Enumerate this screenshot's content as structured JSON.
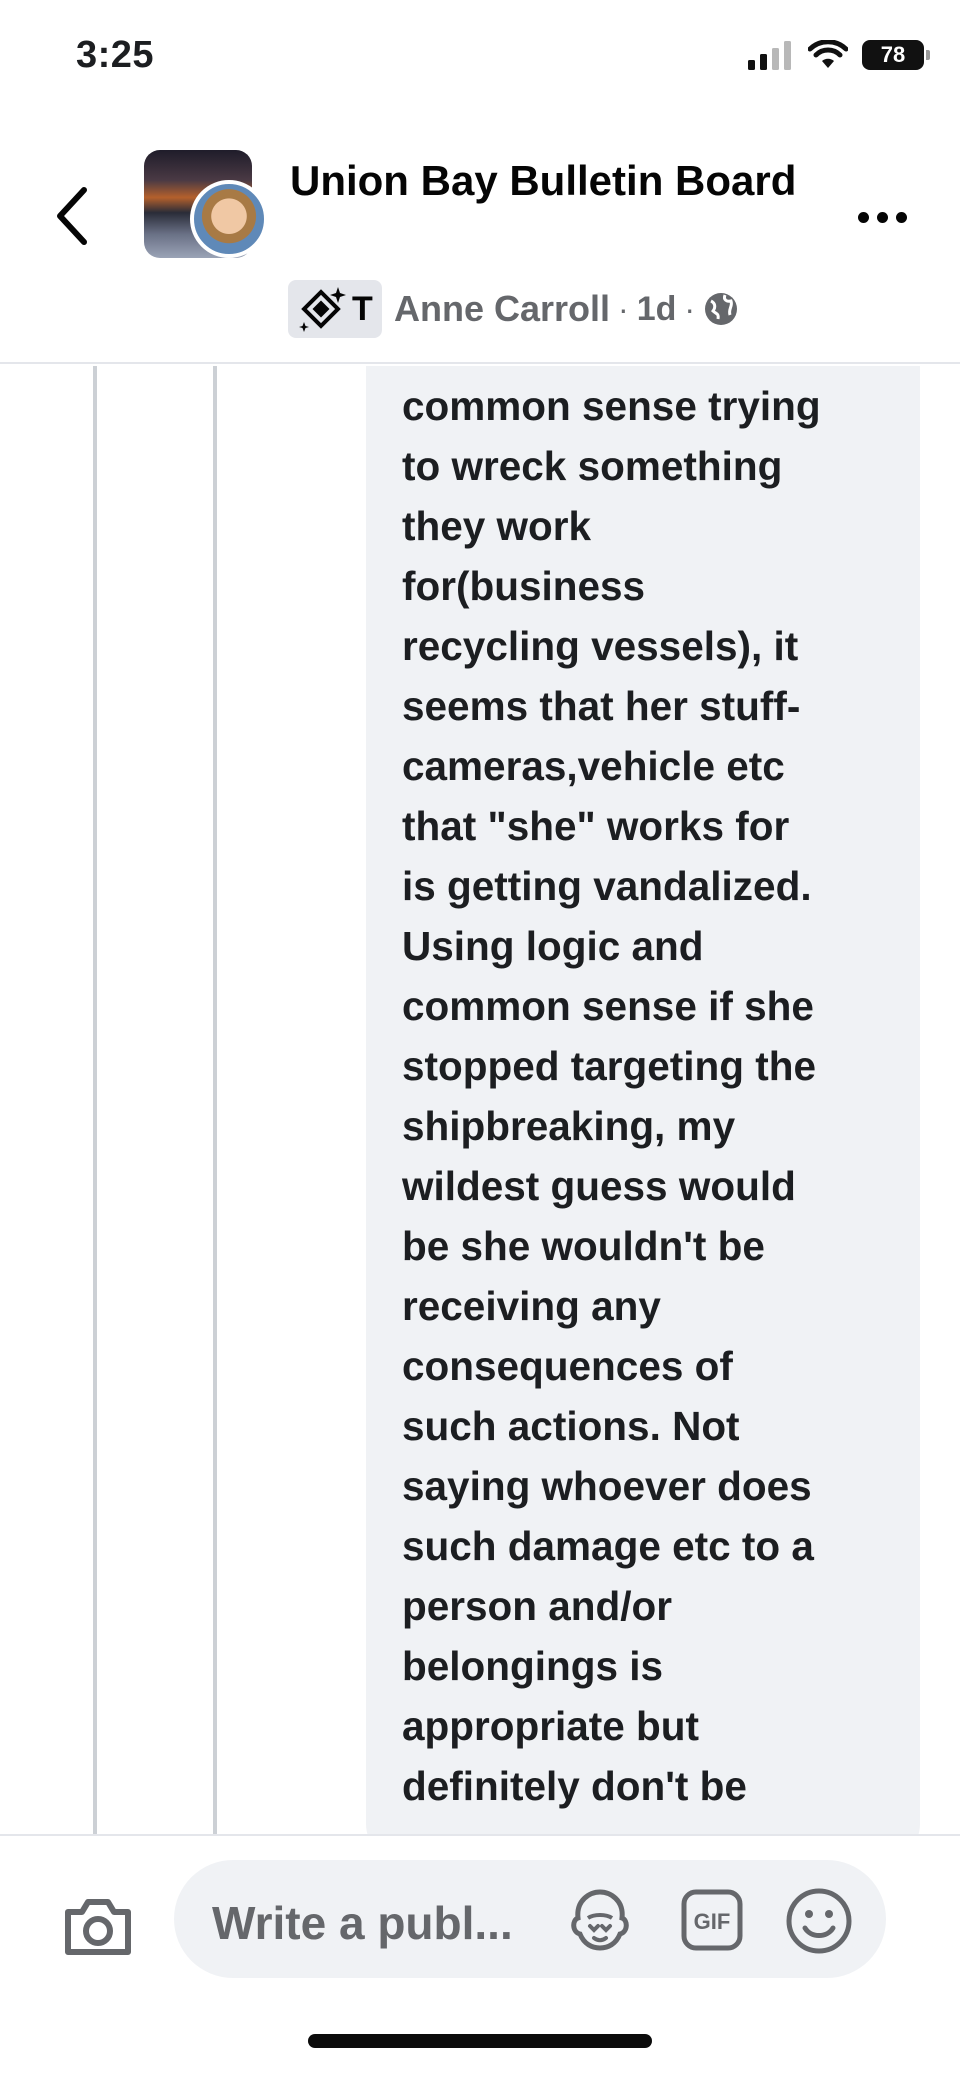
{
  "status_bar": {
    "time": "3:25",
    "battery": "78",
    "icons": [
      "cellular-signal-icon",
      "wifi-icon",
      "battery-icon"
    ]
  },
  "header": {
    "back_icon": "chevron-left-icon",
    "group_title": "Union Bay Bulletin Board",
    "more_icon": "more-dots-icon",
    "badge_letter": "T",
    "author": "Anne Carroll",
    "separator": "·",
    "time_ago": "1d",
    "privacy_icon": "globe-icon"
  },
  "comment": {
    "lines": [
      "common sense trying",
      "to wreck something",
      "they work",
      "for(business",
      "recycling vessels), it",
      "seems that her stuff-",
      "cameras,vehicle etc",
      "that \"she\" works for",
      "is getting vandalized.",
      "Using logic and",
      "common sense if she",
      "stopped targeting the",
      "shipbreaking, my",
      "wildest guess would",
      "be she wouldn't be",
      "receiving any",
      "consequences of",
      "such actions. Not",
      "saying whoever does",
      "such damage etc to a",
      "person and/or",
      "belongings is",
      "appropriate but",
      "definitely don't be"
    ]
  },
  "composer": {
    "camera_icon": "camera-icon",
    "placeholder": "Write a publ...",
    "avatar_icon": "avatar-sticker-icon",
    "gif_label": "GIF",
    "emoji_icon": "smiley-icon"
  },
  "colors": {
    "bubble_bg": "#f0f2f5",
    "thread_line": "#ccd0d5",
    "secondary_text": "#65676b",
    "primary_text": "#1c1e21"
  }
}
